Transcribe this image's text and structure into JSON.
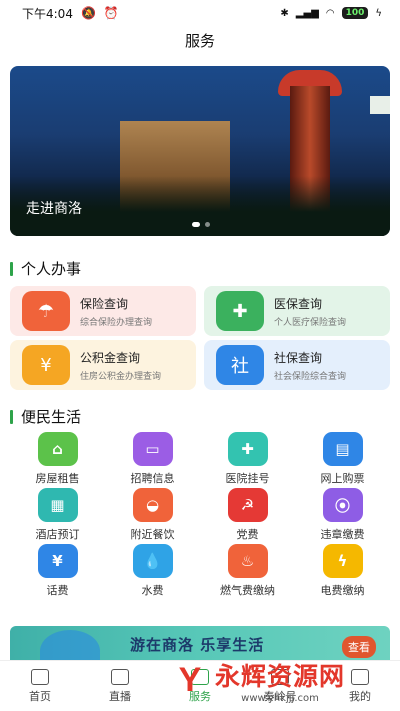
{
  "status_bar": {
    "time": "下午4:04",
    "battery": "100"
  },
  "header": {
    "title": "服务"
  },
  "banner": {
    "caption": "走进商洛"
  },
  "personal": {
    "title": "个人办事",
    "cards": [
      {
        "title": "保险查询",
        "subtitle": "综合保险办理查询",
        "icon": "umbrella-icon",
        "color": "#f0633a",
        "bg": "#fde9e7"
      },
      {
        "title": "医保查询",
        "subtitle": "个人医疗保险查询",
        "icon": "shield-plus-icon",
        "color": "#3bb15e",
        "bg": "#e3f4e8"
      },
      {
        "title": "公积金查询",
        "subtitle": "住房公积金办理查询",
        "icon": "house-money-icon",
        "color": "#f5a623",
        "bg": "#fdf3df"
      },
      {
        "title": "社保查询",
        "subtitle": "社会保险综合查询",
        "icon": "social-security-icon",
        "color": "#2f86e6",
        "bg": "#e4effc"
      }
    ]
  },
  "life": {
    "title": "便民生活",
    "items": [
      {
        "label": "房屋租售",
        "icon": "house-icon",
        "color": "#5cc24a"
      },
      {
        "label": "招聘信息",
        "icon": "briefcase-icon",
        "color": "#9b5de5"
      },
      {
        "label": "医院挂号",
        "icon": "medical-kit-icon",
        "color": "#33c3b0"
      },
      {
        "label": "网上购票",
        "icon": "ticket-icon",
        "color": "#2f86e6"
      },
      {
        "label": "酒店预订",
        "icon": "hotel-icon",
        "color": "#2fb8b0"
      },
      {
        "label": "附近餐饮",
        "icon": "dish-icon",
        "color": "#f0633a"
      },
      {
        "label": "党费",
        "icon": "party-emblem-icon",
        "color": "#e53935"
      },
      {
        "label": "违章缴费",
        "icon": "traffic-light-icon",
        "color": "#8e5de5"
      },
      {
        "label": "话费",
        "icon": "phone-bill-icon",
        "color": "#2f86e6"
      },
      {
        "label": "水费",
        "icon": "water-drop-icon",
        "color": "#2fa3e6"
      },
      {
        "label": "燃气费缴纳",
        "icon": "flame-icon",
        "color": "#f0633a"
      },
      {
        "label": "电费缴纳",
        "icon": "lightning-icon",
        "color": "#f5b800"
      }
    ]
  },
  "promo": {
    "text": "游在商洛 乐享生活",
    "button": "查看"
  },
  "tabbar": {
    "tabs": [
      {
        "label": "首页",
        "icon": "home-icon"
      },
      {
        "label": "直播",
        "icon": "tv-icon"
      },
      {
        "label": "服务",
        "icon": "service-icon"
      },
      {
        "label": "秦岭号",
        "icon": "qinling-icon"
      },
      {
        "label": "我的",
        "icon": "profile-icon"
      }
    ]
  },
  "watermark": {
    "title": "永辉资源网",
    "url": "www.yhkjjj.com"
  }
}
